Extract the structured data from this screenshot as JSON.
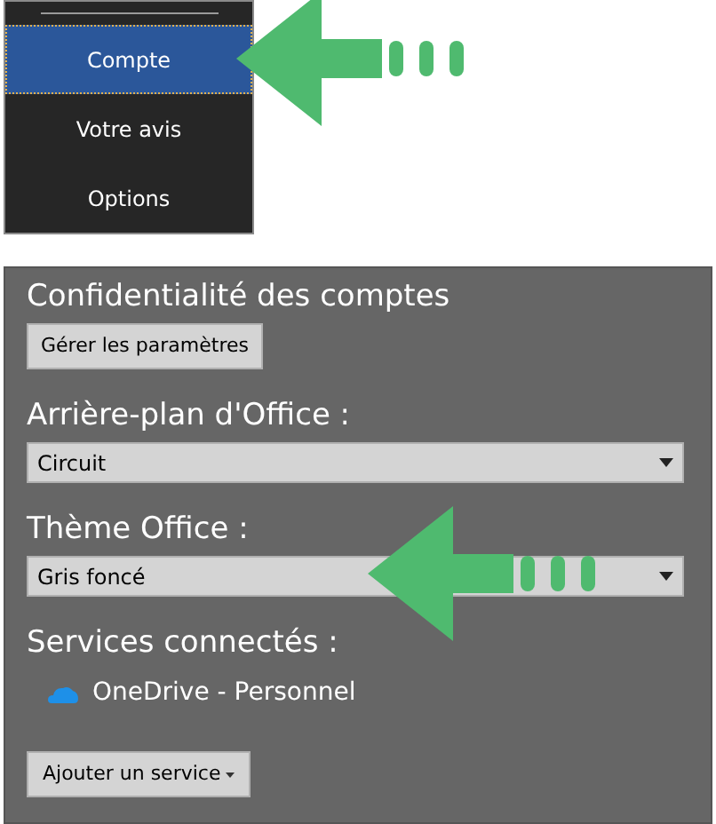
{
  "menu": {
    "items": [
      {
        "label": "Compte",
        "selected": true
      },
      {
        "label": "Votre avis",
        "selected": false
      },
      {
        "label": "Options",
        "selected": false
      }
    ]
  },
  "account_privacy": {
    "heading": "Confidentialité des comptes",
    "button": "Gérer les paramètres"
  },
  "office_background": {
    "label": "Arrière-plan d'Office :",
    "value": "Circuit"
  },
  "office_theme": {
    "label": "Thème Office :",
    "value": "Gris foncé"
  },
  "connected_services": {
    "heading": "Services connectés :",
    "services": [
      {
        "name": "OneDrive - Personnel"
      }
    ],
    "add_button": "Ajouter un service"
  }
}
